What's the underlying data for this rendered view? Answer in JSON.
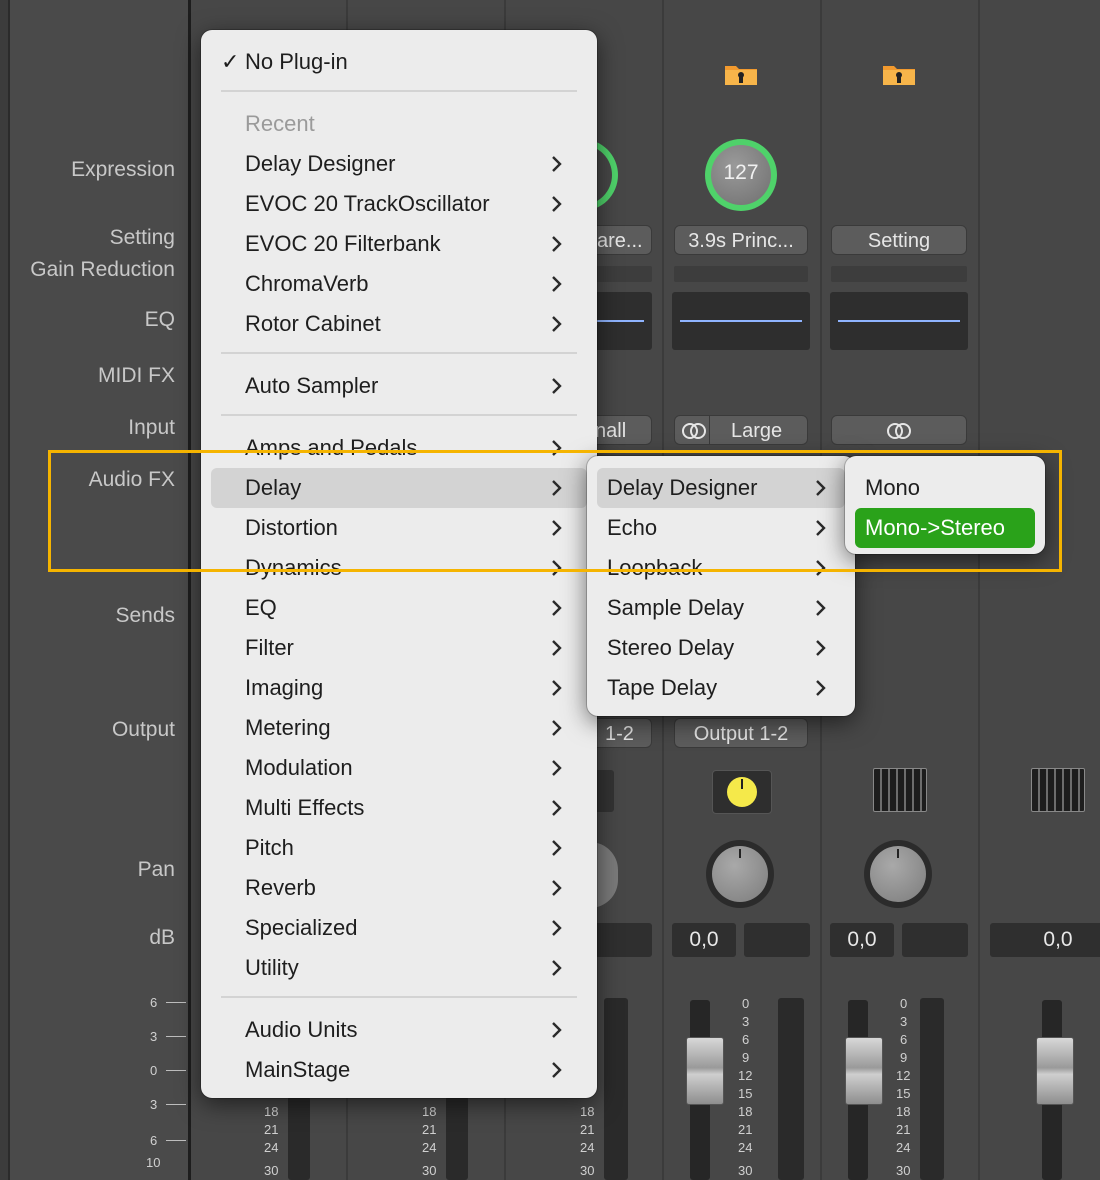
{
  "labels": {
    "expression": "Expression",
    "setting": "Setting",
    "gain_reduction": "Gain Reduction",
    "eq": "EQ",
    "midi_fx": "MIDI FX",
    "input": "Input",
    "audio_fx": "Audio FX",
    "sends": "Sends",
    "output": "Output",
    "pan": "Pan",
    "db": "dB"
  },
  "strips": {
    "expression_value": "127",
    "setting_partial": "are...",
    "setting_2": "3.9s Princ...",
    "setting_3": "Setting",
    "input_partial": "nall",
    "input_2": "Large",
    "output_partial": "1-2",
    "output_2": "Output 1-2",
    "db_1": "0,0",
    "db_2": "0,0",
    "db_3": "0,0"
  },
  "scale": {
    "left": [
      "6",
      "3",
      "0",
      "3",
      "6",
      "10"
    ],
    "meter": [
      "0",
      "3",
      "6",
      "9",
      "12",
      "15",
      "18",
      "21",
      "24",
      "30"
    ],
    "meter_partial": [
      "18",
      "21",
      "24",
      "30"
    ]
  },
  "main_menu": {
    "check": "✓",
    "no_plugin": "No Plug-in",
    "recent_header": "Recent",
    "recent": [
      "Delay Designer",
      "EVOC 20 TrackOscillator",
      "EVOC 20 Filterbank",
      "ChromaVerb",
      "Rotor Cabinet"
    ],
    "auto_sampler": "Auto Sampler",
    "categories": [
      "Amps and Pedals",
      "Delay",
      "Distortion",
      "Dynamics",
      "EQ",
      "Filter",
      "Imaging",
      "Metering",
      "Modulation",
      "Multi Effects",
      "Pitch",
      "Reverb",
      "Specialized",
      "Utility"
    ],
    "bottom": [
      "Audio Units",
      "MainStage"
    ]
  },
  "delay_menu": {
    "items": [
      "Delay Designer",
      "Echo",
      "Loopback",
      "Sample Delay",
      "Stereo Delay",
      "Tape Delay"
    ]
  },
  "format_menu": {
    "items": [
      "Mono",
      "Mono->Stereo"
    ]
  },
  "colors": {
    "menu_bg": "#ececec",
    "selected_green": "#2aa21a",
    "highlight_frame": "#f5b400",
    "knob_ring": "#4fd26a"
  }
}
